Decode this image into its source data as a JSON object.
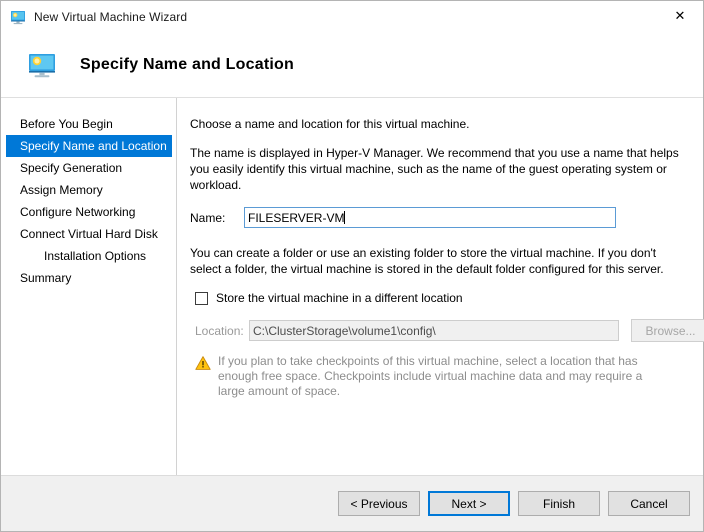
{
  "window": {
    "title": "New Virtual Machine Wizard",
    "icon": "virtual-machine-monitor-icon",
    "close_label": "✕"
  },
  "banner": {
    "icon": "virtual-machine-monitor-icon",
    "title": "Specify Name and Location"
  },
  "sidebar": {
    "items": [
      {
        "label": "Before You Begin",
        "selected": false,
        "sub": false
      },
      {
        "label": "Specify Name and Location",
        "selected": true,
        "sub": false
      },
      {
        "label": "Specify Generation",
        "selected": false,
        "sub": false
      },
      {
        "label": "Assign Memory",
        "selected": false,
        "sub": false
      },
      {
        "label": "Configure Networking",
        "selected": false,
        "sub": false
      },
      {
        "label": "Connect Virtual Hard Disk",
        "selected": false,
        "sub": false
      },
      {
        "label": "Installation Options",
        "selected": false,
        "sub": true
      },
      {
        "label": "Summary",
        "selected": false,
        "sub": false
      }
    ]
  },
  "content": {
    "intro": "Choose a name and location for this virtual machine.",
    "description": "The name is displayed in Hyper-V Manager. We recommend that you use a name that helps you easily identify this virtual machine, such as the name of the guest operating system or workload.",
    "name_label": "Name:",
    "name_value": "FILESERVER-VM",
    "folder_description": "You can create a folder or use an existing folder to store the virtual machine. If you don't select a folder, the virtual machine is stored in the default folder configured for this server.",
    "store_checkbox_label": "Store the virtual machine in a different location",
    "store_checkbox_checked": false,
    "location_label": "Location:",
    "location_value": "C:\\ClusterStorage\\volume1\\config\\",
    "browse_label": "Browse...",
    "warning_icon": "warning-triangle-icon",
    "warning_text": "If you plan to take checkpoints of this virtual machine, select a location that has enough free space. Checkpoints include virtual machine data and may require a large amount of space."
  },
  "footer": {
    "previous_label": "< Previous",
    "next_label": "Next >",
    "finish_label": "Finish",
    "cancel_label": "Cancel"
  },
  "colors": {
    "accent": "#0078d7",
    "footer_bg": "#f0f0f0",
    "warning": "#ffc20e"
  }
}
